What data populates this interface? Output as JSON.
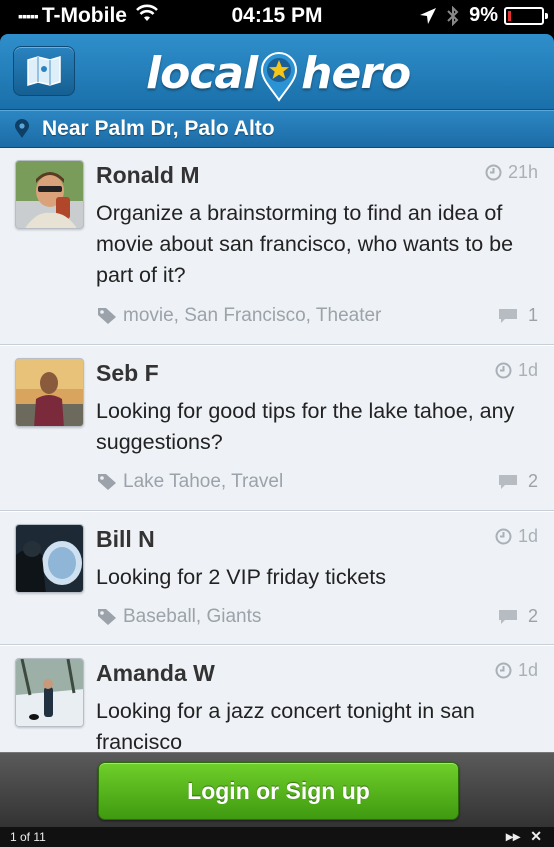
{
  "status_bar": {
    "carrier": "T-Mobile",
    "time": "04:15 PM",
    "battery": "9%",
    "battery_level": 0.09
  },
  "header": {
    "logo_left": "local",
    "logo_right": "hero"
  },
  "location": {
    "label": "Near Palm Dr, Palo Alto"
  },
  "posts": [
    {
      "author": "Ronald M",
      "time": "21h",
      "message": "Organize a brainstorming to find an idea of movie about san francisco, who wants to be part of it?",
      "tags": "movie, San Francisco, Theater",
      "comments": "1"
    },
    {
      "author": "Seb F",
      "time": "1d",
      "message": "Looking for good tips for the lake tahoe, any suggestions?",
      "tags": "Lake Tahoe, Travel",
      "comments": "2"
    },
    {
      "author": "Bill N",
      "time": "1d",
      "message": "Looking for 2 VIP friday tickets",
      "tags": "Baseball, Giants",
      "comments": "2"
    },
    {
      "author": "Amanda W",
      "time": "1d",
      "message": "Looking for a jazz concert tonight in san francisco",
      "tags": "",
      "comments": ""
    }
  ],
  "login_button": {
    "label": "Login or Sign up"
  },
  "pager": {
    "count": "1 of 11"
  },
  "colors": {
    "header_blue": "#1f78b5",
    "button_green": "#4caf1a",
    "feed_bg": "#eef2f6"
  }
}
